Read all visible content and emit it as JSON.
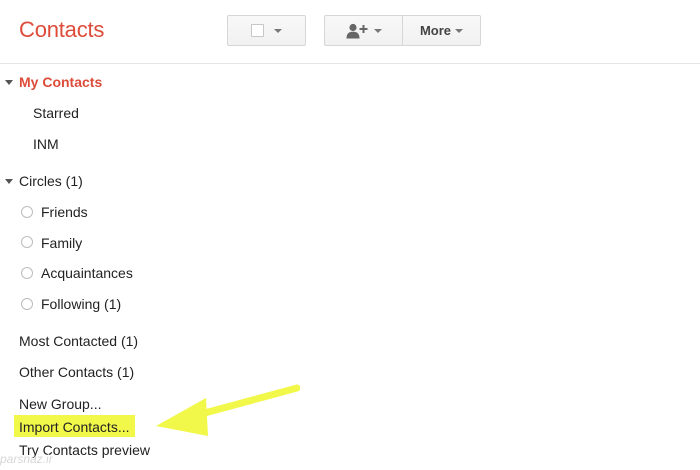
{
  "header": {
    "title": "Contacts",
    "more_label": "More",
    "icons": {
      "select": "checkbox-icon",
      "add_contact": "add-person-icon",
      "dropdown": "chevron-down-icon"
    }
  },
  "sidebar": {
    "my_contacts": "My Contacts",
    "my_contacts_items": [
      "Starred",
      "INM"
    ],
    "circles": "Circles (1)",
    "circle_items": [
      "Friends",
      "Family",
      "Acquaintances",
      "Following (1)"
    ],
    "most_contacted": "Most Contacted (1)",
    "other_contacts": "Other Contacts (1)",
    "new_group": "New Group...",
    "import_contacts": "Import Contacts...",
    "try_preview": "Try Contacts preview"
  },
  "annotation": {
    "arrow_color": "#f2f84a",
    "highlight_color": "#f2f84a"
  },
  "watermark": "parsnaz.ir",
  "colors": {
    "accent": "#dd4b39"
  }
}
